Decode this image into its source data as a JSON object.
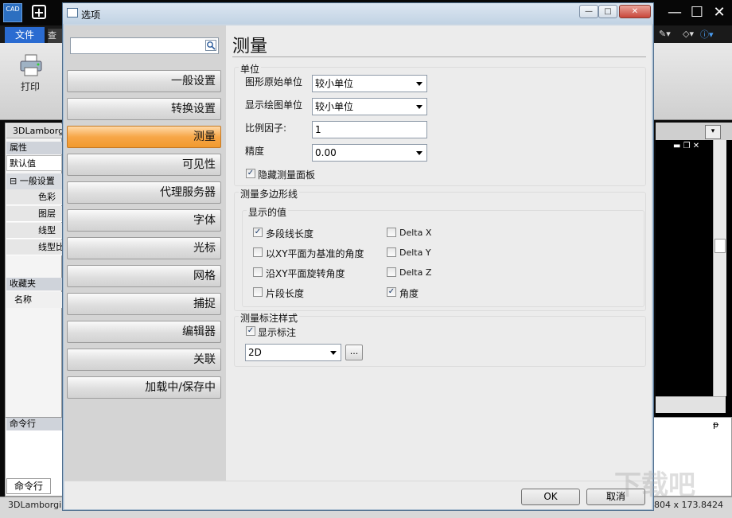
{
  "app": {
    "logo_text": "CAD",
    "tab_file": "文件",
    "tab_second": "查",
    "ribbon_print": "打印",
    "doc_tab": "3DLamborg",
    "props_header": "属性",
    "props_default": "默认值",
    "props_group": "⊟ 一般设置",
    "props_items": [
      "色彩",
      "图层",
      "线型",
      "线型比"
    ],
    "favorites_header": "收藏夹",
    "favorites_name_col": "名称",
    "cmd_header": "命令行",
    "cmd_tab": "命令行",
    "status_left": "3DLamborgi",
    "status_right": "804 x 173.8424",
    "watermark": "下载吧"
  },
  "dialog": {
    "title": "选项",
    "search_placeholder": "",
    "nav_items": [
      {
        "label": "一般设置",
        "active": false
      },
      {
        "label": "转换设置",
        "active": false
      },
      {
        "label": "测量",
        "active": true
      },
      {
        "label": "可见性",
        "active": false
      },
      {
        "label": "代理服务器",
        "active": false
      },
      {
        "label": "字体",
        "active": false
      },
      {
        "label": "光标",
        "active": false
      },
      {
        "label": "网格",
        "active": false
      },
      {
        "label": "捕捉",
        "active": false
      },
      {
        "label": "编辑器",
        "active": false
      },
      {
        "label": "关联",
        "active": false
      },
      {
        "label": "加载中/保存中",
        "active": false
      }
    ],
    "heading": "测量",
    "units_group": {
      "title": "单位",
      "original_unit_label": "图形原始单位",
      "original_unit_value": "较小单位",
      "display_unit_label": "显示绘图单位",
      "display_unit_value": "较小单位",
      "scale_label": "比例因子:",
      "scale_value": "1",
      "precision_label": "精度",
      "precision_value": "0.00",
      "hide_panel_label": "隐藏测量面板",
      "hide_panel_checked": true
    },
    "polyline_group": {
      "title": "测量多边形线",
      "sub_title": "显示的值",
      "left_options": [
        {
          "label": "多段线长度",
          "checked": true
        },
        {
          "label": "以XY平面为基准的角度",
          "checked": false
        },
        {
          "label": "沿XY平面旋转角度",
          "checked": false
        },
        {
          "label": "片段长度",
          "checked": false
        }
      ],
      "right_options": [
        {
          "label": "Delta X",
          "checked": false
        },
        {
          "label": "Delta Y",
          "checked": false
        },
        {
          "label": "Delta Z",
          "checked": false
        },
        {
          "label": "角度",
          "checked": true
        }
      ]
    },
    "annotation_group": {
      "title": "测量标注样式",
      "show_label": "显示标注",
      "show_checked": true,
      "style_value": "2D",
      "ellipsis": "..."
    },
    "ok": "OK",
    "cancel": "取消",
    "btn_min": "—",
    "btn_max": "□",
    "btn_close": "✕"
  }
}
